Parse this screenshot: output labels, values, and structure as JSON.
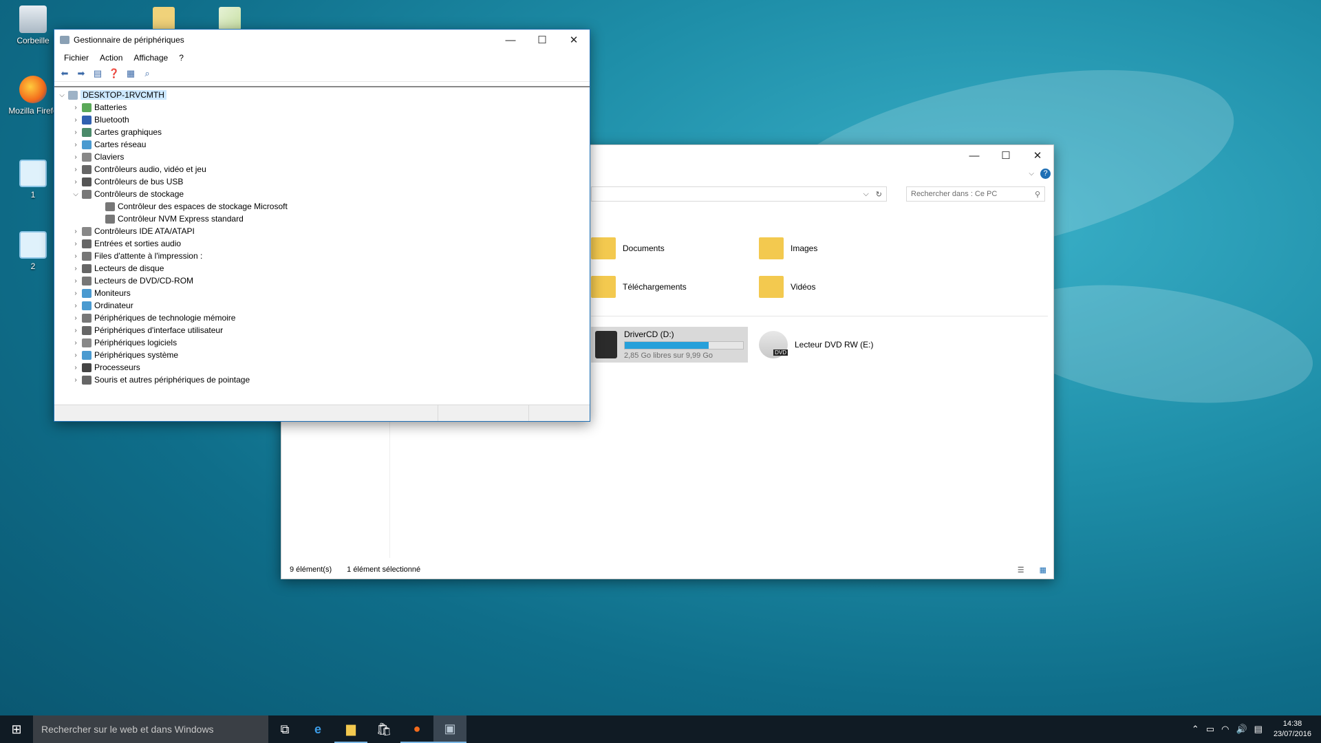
{
  "desktop": {
    "icons": [
      {
        "label": "Corbeille",
        "icon": "recycle-bin-icon"
      },
      {
        "label": "Mozilla Firefo",
        "icon": "firefox-icon"
      },
      {
        "label": "1",
        "icon": "monitor-icon"
      },
      {
        "label": "2",
        "icon": "monitor-icon"
      }
    ]
  },
  "device_manager": {
    "title": "Gestionnaire de périphériques",
    "menu": [
      "Fichier",
      "Action",
      "Affichage",
      "?"
    ],
    "root": "DESKTOP-1RVCMTH",
    "nodes": [
      {
        "label": "Batteries",
        "expanded": false
      },
      {
        "label": "Bluetooth",
        "expanded": false
      },
      {
        "label": "Cartes graphiques",
        "expanded": false
      },
      {
        "label": "Cartes réseau",
        "expanded": false
      },
      {
        "label": "Claviers",
        "expanded": false
      },
      {
        "label": "Contrôleurs audio, vidéo et jeu",
        "expanded": false
      },
      {
        "label": "Contrôleurs de bus USB",
        "expanded": false
      },
      {
        "label": "Contrôleurs de stockage",
        "expanded": true
      },
      {
        "label": "Contrôleur des espaces de stockage Microsoft",
        "child": true
      },
      {
        "label": "Contrôleur NVM Express standard",
        "child": true
      },
      {
        "label": "Contrôleurs IDE ATA/ATAPI",
        "expanded": false
      },
      {
        "label": "Entrées et sorties audio",
        "expanded": false
      },
      {
        "label": "Files d'attente à l'impression :",
        "expanded": false
      },
      {
        "label": "Lecteurs de disque",
        "expanded": false
      },
      {
        "label": "Lecteurs de DVD/CD-ROM",
        "expanded": false
      },
      {
        "label": "Moniteurs",
        "expanded": false
      },
      {
        "label": "Ordinateur",
        "expanded": false
      },
      {
        "label": "Périphériques de technologie mémoire",
        "expanded": false
      },
      {
        "label": "Périphériques d'interface utilisateur",
        "expanded": false
      },
      {
        "label": "Périphériques logiciels",
        "expanded": false
      },
      {
        "label": "Périphériques système",
        "expanded": false
      },
      {
        "label": "Processeurs",
        "expanded": false
      },
      {
        "label": "Souris et autres périphériques de pointage",
        "expanded": false
      }
    ]
  },
  "explorer": {
    "search_placeholder": "Rechercher dans : Ce PC",
    "folders": [
      "Documents",
      "Images",
      "Téléchargements",
      "Vidéos"
    ],
    "drive_d": {
      "name": "DriverCD (D:)",
      "free": "2,85 Go libres sur 9,99 Go",
      "used_fraction": 0.71
    },
    "drive_e": {
      "name": "Lecteur DVD RW (E:)",
      "badge": "DVD"
    },
    "status_count": "9 élément(s)",
    "status_selected": "1 élément sélectionné"
  },
  "taskbar": {
    "search_placeholder": "Rechercher sur le web et dans Windows",
    "time": "14:38",
    "date": "23/07/2016"
  },
  "colors": {
    "accent": "#1e6fb5",
    "taskbar": "#101b24",
    "selection": "#cce8ff",
    "progress": "#26a0da"
  }
}
